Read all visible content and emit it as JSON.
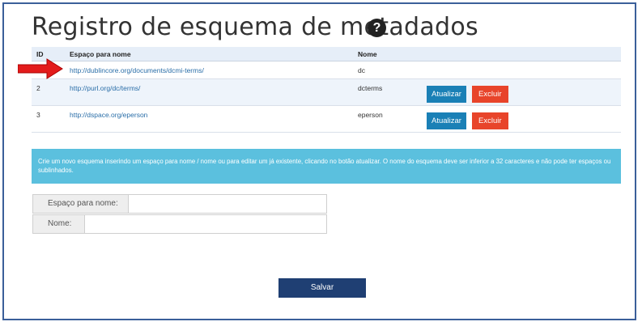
{
  "page": {
    "title": "Registro de esquema de metadados",
    "help_icon": "?"
  },
  "table": {
    "headers": {
      "id": "ID",
      "namespace": "Espaço para nome",
      "name": "Nome"
    },
    "rows": [
      {
        "id": "",
        "namespace": "http://dublincore.org/documents/dcmi-terms/",
        "name": "dc",
        "actions": false
      },
      {
        "id": "2",
        "namespace": "http://purl.org/dc/terms/",
        "name": "dcterms",
        "actions": true
      },
      {
        "id": "3",
        "namespace": "http://dspace.org/eperson",
        "name": "eperson",
        "actions": true
      }
    ],
    "update_label": "Atualizar",
    "delete_label": "Excluir"
  },
  "info": {
    "text": "Crie um novo esquema inserindo um espaço para nome / nome ou para editar um já existente, clicando no botão atualizar. O nome do esquema deve ser inferior a 32 caracteres e não pode ter espaços ou sublinhados."
  },
  "form": {
    "namespace_label": "Espaço para nome:",
    "namespace_value": "",
    "name_label": "Nome:",
    "name_value": "",
    "save_label": "Salvar"
  },
  "colors": {
    "update": "#1a80b6",
    "delete": "#e8442a",
    "info_bg": "#5bc0de",
    "save_bg": "#1f3f73",
    "annotation_arrow": "#e31b1b"
  }
}
